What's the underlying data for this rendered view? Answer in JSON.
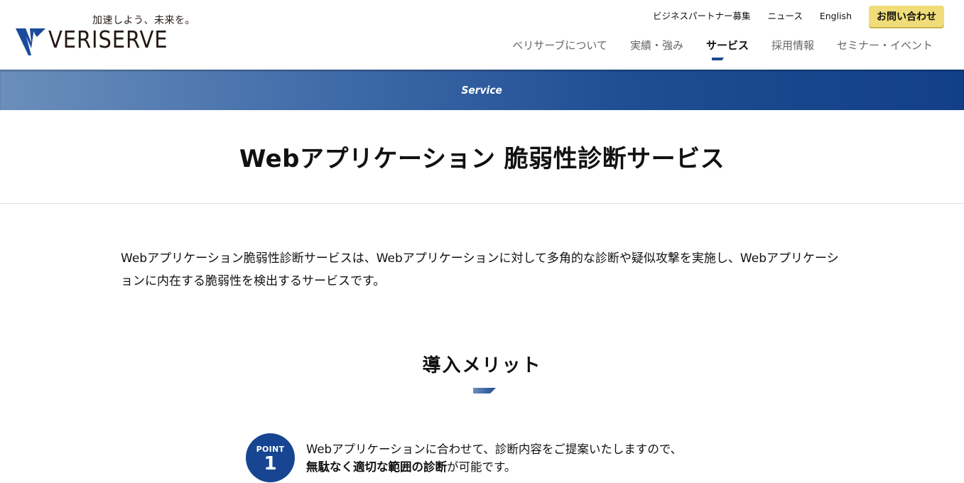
{
  "header": {
    "logo": {
      "tagline": "加速しよう、未来を。",
      "wordmark": "VERISERVE",
      "mark_icon": "veriserve-v-icon"
    },
    "util_nav": [
      {
        "label": "ビジネスパートナー募集"
      },
      {
        "label": "ニュース"
      },
      {
        "label": "English"
      }
    ],
    "contact_button": "お問い合わせ",
    "main_nav": [
      {
        "label": "ベリサーブについて",
        "active": false
      },
      {
        "label": "実績・強み",
        "active": false
      },
      {
        "label": "サービス",
        "active": true
      },
      {
        "label": "採用情報",
        "active": false
      },
      {
        "label": "セミナー・イベント",
        "active": false
      }
    ]
  },
  "banner": {
    "label": "Service"
  },
  "page": {
    "title": "Webアプリケーション 脆弱性診断サービス",
    "intro": "Webアプリケーション脆弱性診断サービスは、Webアプリケーションに対して多角的な診断や疑似攻撃を実施し、Webアプリケーションに内在する脆弱性を検出するサービスです。"
  },
  "merits": {
    "title": "導入メリット",
    "points": [
      {
        "label": "POINT",
        "number": "1",
        "line1": "Webアプリケーションに合わせて、診断内容をご提案いたしますので、",
        "line2_bold": "無駄なく適切な範囲の診断",
        "line2_rest": "が可能です。"
      }
    ]
  },
  "colors": {
    "brand_blue": "#174591",
    "contact_yellow": "#f0dc78",
    "divider": "#e0e0e0"
  }
}
